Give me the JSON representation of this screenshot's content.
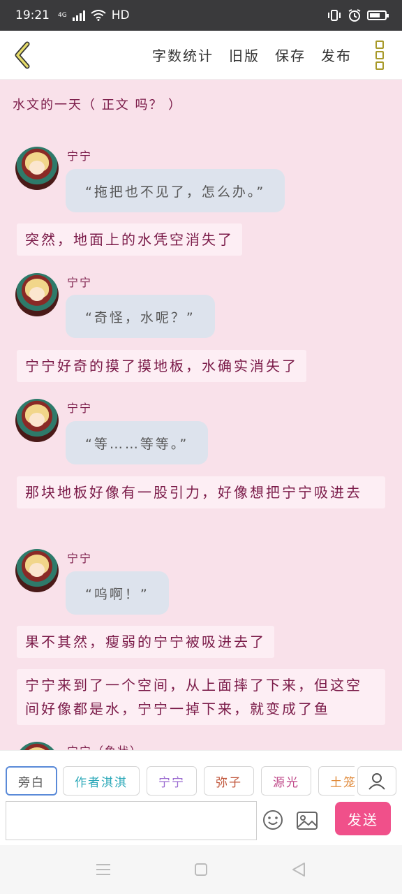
{
  "status_bar": {
    "time": "19:21",
    "network": "4G",
    "hd": "HD"
  },
  "toolbar": {
    "word_count": "字数统计",
    "old_version": "旧版",
    "save": "保存",
    "publish": "发布"
  },
  "story": {
    "title": "水文的一天（ 正文 吗？ ）"
  },
  "messages": [
    {
      "name": "宁宁",
      "text": "“拖把也不见了，怎么办。”"
    },
    {
      "narration": "突然，地面上的水凭空消失了"
    },
    {
      "name": "宁宁",
      "text": "“奇怪，水呢？”"
    },
    {
      "narration": "宁宁好奇的摸了摸地板，水确实消失了"
    },
    {
      "name": "宁宁",
      "text": "“等……等等。”"
    },
    {
      "narration": "那块地板好像有一股引力，好像想把宁宁吸进去"
    },
    {
      "name": "宁宁",
      "text": "“呜啊！”"
    },
    {
      "narration": "果不其然，瘦弱的宁宁被吸进去了"
    },
    {
      "narration": "宁宁来到了一个空间，从上面摔了下来，但这空间好像都是水，宁宁一掉下来，就变成了鱼"
    },
    {
      "name": "宁宁（鱼状）"
    }
  ],
  "role_chips": [
    {
      "label": "旁白",
      "color": "#555555"
    },
    {
      "label": "作者淇淇",
      "color": "#2aa8b8"
    },
    {
      "label": "宁宁",
      "color": "#9a6ad0"
    },
    {
      "label": "弥子",
      "color": "#c0553a"
    },
    {
      "label": "源光",
      "color": "#c04a8a"
    },
    {
      "label": "土笼",
      "color": "#e08a3a"
    }
  ],
  "composer": {
    "input_value": "",
    "send": "发送"
  },
  "icons": {
    "back": "chevron-left-icon",
    "more": "more-vertical-icon",
    "user": "user-icon",
    "emoji": "emoji-icon",
    "image": "image-icon"
  }
}
